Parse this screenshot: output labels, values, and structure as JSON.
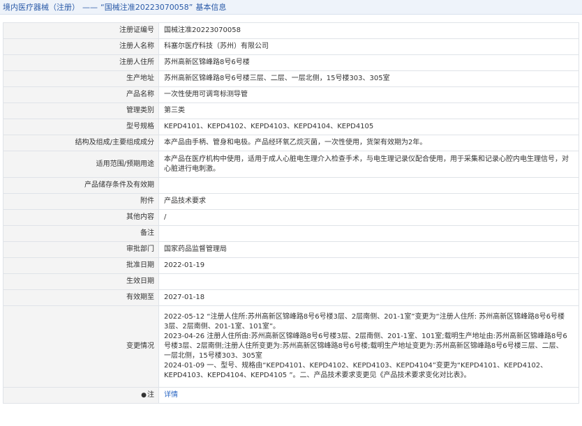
{
  "header": {
    "crumb": "境内医疗器械（注册）",
    "separator": "——",
    "tag": "“国械注准20223070058”",
    "suffix": "基本信息"
  },
  "rows": [
    {
      "label": "注册证编号",
      "value": "国械注准20223070058"
    },
    {
      "label": "注册人名称",
      "value": "科塞尔医疗科技（苏州）有限公司"
    },
    {
      "label": "注册人住所",
      "value": "苏州高新区锦峰路8号6号楼"
    },
    {
      "label": "生产地址",
      "value": "苏州高新区锦峰路8号6号楼三层、二层、一层北侧，15号楼303、305室"
    },
    {
      "label": "产品名称",
      "value": "一次性使用可调弯标测导管"
    },
    {
      "label": "管理类别",
      "value": "第三类"
    },
    {
      "label": "型号规格",
      "value": "KEPD4101、KEPD4102、KEPD4103、KEPD4104、KEPD4105"
    },
    {
      "label": "结构及组成/主要组成成分",
      "value": "本产品由手柄、管身和电极。产品经环氧乙烷灭菌，一次性使用，货架有效期为2年。"
    },
    {
      "label": "适用范围/预期用途",
      "value": "本产品在医疗机构中使用，适用于成人心脏电生理介入检查手术，与电生理记录仪配合使用，用于采集和记录心腔内电生理信号，对心脏进行电刺激。"
    },
    {
      "label": "产品储存条件及有效期",
      "value": ""
    },
    {
      "label": "附件",
      "value": "产品技术要求"
    },
    {
      "label": "其他内容",
      "value": "/"
    },
    {
      "label": "备注",
      "value": ""
    },
    {
      "label": "审批部门",
      "value": "国家药品监督管理局"
    },
    {
      "label": "批准日期",
      "value": "2022-01-19"
    },
    {
      "label": "生效日期",
      "value": ""
    },
    {
      "label": "有效期至",
      "value": "2027-01-18"
    }
  ],
  "changes": {
    "label": "变更情况",
    "entries": [
      "2022-05-12 “注册人住所:苏州高新区锦峰路8号6号楼3层、2层南侧、201-1室”变更为“注册人住所: 苏州高新区锦峰路8号6号楼3层、2层南侧、201-1室、101室”。",
      "2023-04-26 注册人住所由:苏州高新区锦峰路8号6号楼3层、2层南侧、201-1室、101室;载明生产地址由:苏州高新区锦峰路8号6号楼3层、2层南侧;注册人住所变更为:苏州高新区锦峰路8号6号楼;载明生产地址变更为:苏州高新区锦峰路8号6号楼三层、二层、一层北侧，15号楼303、305室",
      "2024-01-09 一、型号、规格由“KEPD4101、KEPD4102、KEPD4103、KEPD4104”变更为“KEPD4101、KEPD4102、KEPD4103、KEPD4104、KEPD4105 ”。二、产品技术要求变更见《产品技术要求变化对比表》。"
    ]
  },
  "note": {
    "label": "注",
    "pin_icon": "pin-icon",
    "link": "详情"
  }
}
